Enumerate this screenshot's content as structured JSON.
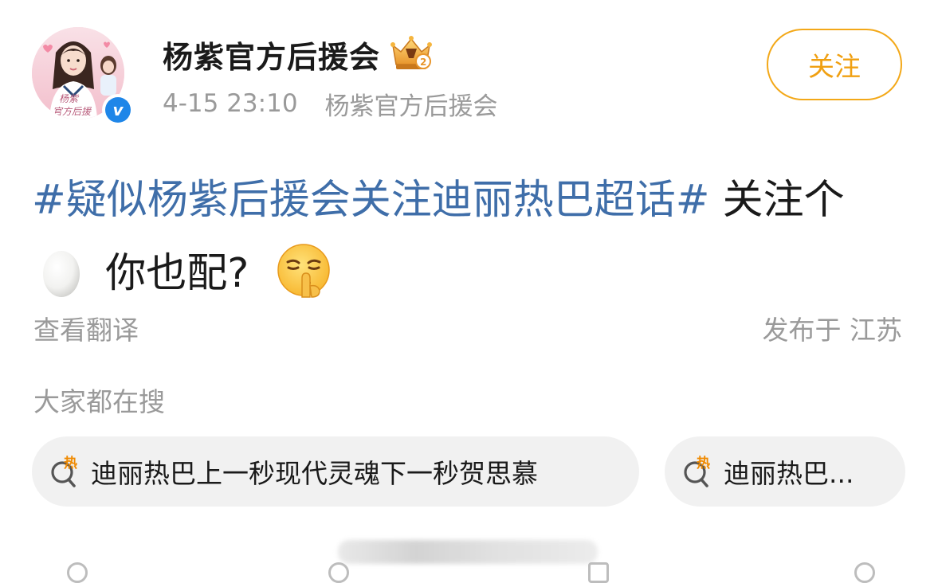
{
  "post": {
    "author": {
      "name": "杨紫官方后援会",
      "verified": true,
      "avatar_caption": "杨紫 官方后援"
    },
    "timestamp": "4-15 23:10",
    "source": "杨紫官方后援会",
    "follow_label": "关注",
    "text": {
      "topic": "#疑似杨紫后援会关注迪丽热巴超话#",
      "segment_1": " 关注个",
      "segment_2": " 你也配? "
    },
    "emoji": [
      "egg-icon",
      "shushing-face-icon"
    ],
    "translate_label": "查看翻译",
    "location_label": "发布于 江苏"
  },
  "trending": {
    "label": "大家都在搜",
    "hot_badge": "热",
    "items": [
      {
        "text": "迪丽热巴上一秒现代灵魂下一秒贺思慕"
      },
      {
        "text": "迪丽热巴..."
      }
    ]
  },
  "colors": {
    "topic": "#3f6ea9",
    "follow": "#f0a012",
    "muted": "#9a9a9a",
    "chip_bg": "#f1f1f1",
    "verified": "#1f86e8",
    "hot": "#f08a00"
  }
}
